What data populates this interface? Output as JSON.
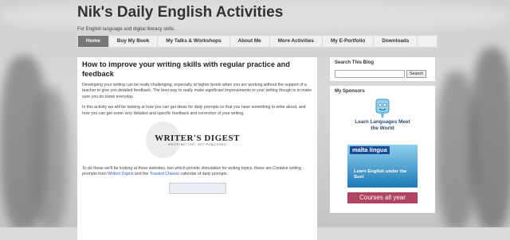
{
  "blog": {
    "title": "Nik's Daily English Activities",
    "description": "For English language and digital literacy skills."
  },
  "nav": {
    "tabs": [
      "Home",
      "Buy My Book",
      "My Talks & Workshops",
      "About Me",
      "More Activities",
      "My E-Portfolio",
      "Downloads"
    ]
  },
  "post": {
    "title": "How to improve your writing skills with regular practice and feedback",
    "para1": "Developing your writing can be really challenging, especially at higher levels when you are working without the support of a teacher to give you detailed feedback. The best way to really make significant improvements to your writing though is to make sure you do some everyday.",
    "para2": "In this activity we will be looking at how you can get ideas for daily prompts so that you have something to write about, and how you can get some very detailed and specific feedback and correction of your writing.",
    "logo_name": "WRITER'S DIGEST",
    "logo_tagline": "WRITE BETTER, GET PUBLISHED",
    "para3_start": "To do these we'll be looking at three websites, two which provide stimulation for writing topics, these are Creative writing prompts from ",
    "link1": "Writers Digest",
    "para3_mid": "  and the ",
    "link2": "Toasted Cheese",
    "para3_end": " calendar of daily prompts."
  },
  "sidebar": {
    "search_title": "Search This Blog",
    "search_button": "Search",
    "sponsors_title": "My Sponsors",
    "sponsor1_text": "Learn Languages Meet the World",
    "sponsor2_logo": "malta lingua",
    "sponsor2_text": "Learn English under the Sun!",
    "sponsor3_text": "Courses all year"
  }
}
